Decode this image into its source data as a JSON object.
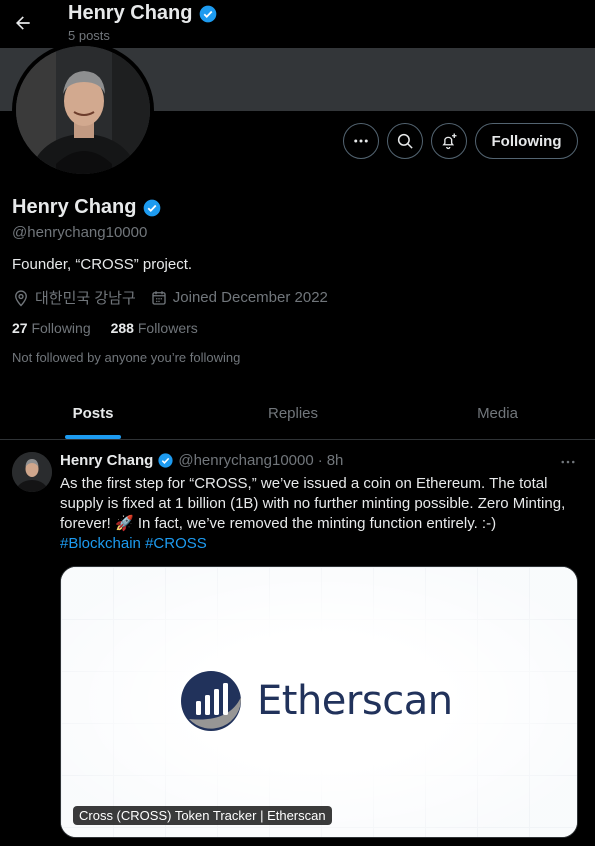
{
  "header": {
    "name": "Henry Chang",
    "posts_count": "5 posts"
  },
  "profile": {
    "name": "Henry Chang",
    "handle": "@henrychang10000",
    "bio": "Founder, “CROSS” project.",
    "location": "대한민국 강남구",
    "joined": "Joined December 2022",
    "following_count": "27",
    "following_label": "Following",
    "followers_count": "288",
    "followers_label": "Followers",
    "followed_by": "Not followed by anyone you’re following",
    "follow_button": "Following"
  },
  "tabs": [
    {
      "label": "Posts",
      "active": true
    },
    {
      "label": "Replies",
      "active": false
    },
    {
      "label": "Media",
      "active": false
    }
  ],
  "post": {
    "name": "Henry Chang",
    "handle": "@henrychang10000",
    "separator": "·",
    "time": "8h",
    "text": "As the first step for “CROSS,” we’ve issued a coin on Ethereum. The total supply is fixed at 1 billion (1B) with no further minting possible. Zero Minting, forever! 🚀 In fact, we’ve removed the minting function entirely. :-)",
    "hashtags": [
      "#Blockchain",
      "#CROSS"
    ],
    "card": {
      "logo_text": "Etherscan",
      "caption": "Cross (CROSS) Token Tracker | Etherscan"
    }
  },
  "colors": {
    "background": "#000000",
    "accent": "#1d9bf0",
    "secondary_text": "#71767b",
    "verified": "#1d9bf0",
    "etherscan_navy": "#21325b"
  },
  "icons": [
    "back-arrow-icon",
    "verified-badge-icon",
    "more-icon",
    "search-icon",
    "bell-plus-icon",
    "location-icon",
    "calendar-icon",
    "rocket-emoji"
  ]
}
